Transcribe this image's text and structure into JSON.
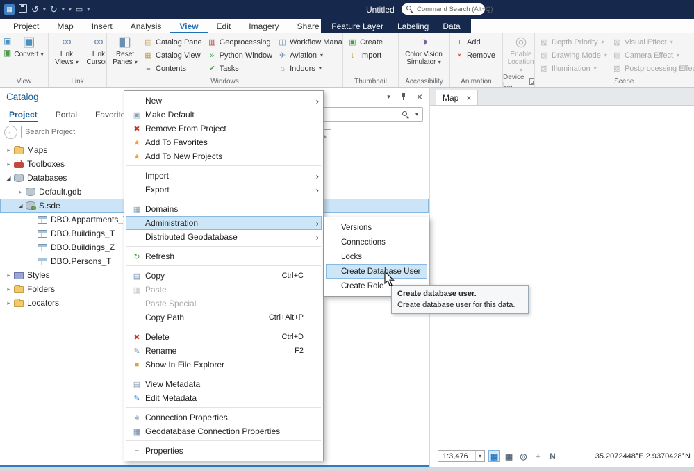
{
  "titlebar": {
    "title": "Untitled",
    "command_search_placeholder": "Command Search (Alt+Q)"
  },
  "ribbon_tabs": {
    "main": [
      "Project",
      "Map",
      "Insert",
      "Analysis",
      "View",
      "Edit",
      "Imagery",
      "Share"
    ],
    "active": "View",
    "contextual": [
      "Feature Layer",
      "Labeling",
      "Data"
    ]
  },
  "ribbon": {
    "groups": [
      {
        "label": "View",
        "minis": [
          "map-frame-icon",
          "scene-frame-icon"
        ],
        "big": [
          {
            "label": "Convert",
            "icon": "convert-icon",
            "dropdown": true
          }
        ]
      },
      {
        "label": "Link",
        "big": [
          {
            "label": "Link Views",
            "icon": "link-views-icon",
            "dropdown": true
          },
          {
            "label": "Link Cursors",
            "icon": "link-cursors-icon"
          }
        ]
      },
      {
        "label": "Windows",
        "big": [
          {
            "label": "Reset Panes",
            "icon": "reset-panes-icon",
            "dropdown": true
          }
        ],
        "small_cols": [
          [
            {
              "label": "Catalog Pane",
              "icon": "catalog-pane-icon"
            },
            {
              "label": "Catalog View",
              "icon": "catalog-view-icon"
            },
            {
              "label": "Contents",
              "icon": "contents-icon"
            }
          ],
          [
            {
              "label": "Geoprocessing",
              "icon": "geoprocessing-icon"
            },
            {
              "label": "Python Window",
              "icon": "python-window-icon"
            },
            {
              "label": "Tasks",
              "icon": "tasks-icon"
            }
          ],
          [
            {
              "label": "Workflow Manager",
              "icon": "workflow-manager-icon",
              "dropdown": true
            },
            {
              "label": "Aviation",
              "icon": "aviation-icon",
              "dropdown": true
            },
            {
              "label": "Indoors",
              "icon": "indoors-icon",
              "dropdown": true
            }
          ]
        ]
      },
      {
        "label": "Thumbnail",
        "small_cols": [
          [
            {
              "label": "Create",
              "icon": "create-thumbnail-icon"
            },
            {
              "label": "Import",
              "icon": "import-thumbnail-icon"
            }
          ]
        ]
      },
      {
        "label": "Accessibility",
        "big": [
          {
            "label": "Color Vision Simulator",
            "icon": "color-vision-simulator-icon",
            "dropdown": true
          }
        ]
      },
      {
        "label": "Animation",
        "small_cols": [
          [
            {
              "label": "Add",
              "icon": "add-icon"
            },
            {
              "label": "Remove",
              "icon": "animation-remove-icon"
            }
          ]
        ]
      },
      {
        "label": "Device L...",
        "launcher": true,
        "big": [
          {
            "label": "Enable Location",
            "icon": "enable-location-icon",
            "dropdown": true,
            "disabled": true
          }
        ]
      },
      {
        "label": "Scene",
        "small_cols": [
          [
            {
              "label": "Depth Priority",
              "icon": "scene-effect-icon",
              "dropdown": true,
              "disabled": true
            },
            {
              "label": "Drawing Mode",
              "icon": "scene-effect-icon",
              "dropdown": true,
              "disabled": true
            },
            {
              "label": "Illumination",
              "icon": "scene-effect-icon",
              "dropdown": true,
              "disabled": true
            }
          ],
          [
            {
              "label": "Visual Effect",
              "icon": "scene-effect-icon",
              "dropdown": true,
              "disabled": true
            },
            {
              "label": "Camera Effect",
              "icon": "scene-effect-icon",
              "dropdown": true,
              "disabled": true
            },
            {
              "label": "Postprocessing Effects",
              "icon": "scene-effect-icon",
              "dropdown": true,
              "disabled": true
            }
          ]
        ]
      }
    ]
  },
  "catalog_pane": {
    "title": "Catalog",
    "tabs": [
      "Project",
      "Portal",
      "Favorites"
    ],
    "active_tab": "Project",
    "search_placeholder": "Search Project",
    "tree": [
      {
        "label": "Maps",
        "depth": 0,
        "state": "collapsed",
        "icon": "folder-icon"
      },
      {
        "label": "Toolboxes",
        "depth": 0,
        "state": "collapsed",
        "icon": "toolbox-icon"
      },
      {
        "label": "Databases",
        "depth": 0,
        "state": "expanded",
        "icon": "databases-icon"
      },
      {
        "label": "Default.gdb",
        "depth": 1,
        "state": "collapsed",
        "icon": "geodatabase-icon"
      },
      {
        "label": "S.sde",
        "depth": 1,
        "state": "expanded",
        "icon": "sde-connection-icon",
        "selected": true
      },
      {
        "label": "DBO.Appartments_T",
        "depth": 2,
        "state": "leaf",
        "icon": "table-icon"
      },
      {
        "label": "DBO.Buildings_T",
        "depth": 2,
        "state": "leaf",
        "icon": "table-icon"
      },
      {
        "label": "DBO.Buildings_Z",
        "depth": 2,
        "state": "leaf",
        "icon": "table-icon"
      },
      {
        "label": "DBO.Persons_T",
        "depth": 2,
        "state": "leaf",
        "icon": "table-icon"
      },
      {
        "label": "Styles",
        "depth": 0,
        "state": "collapsed",
        "icon": "styles-icon"
      },
      {
        "label": "Folders",
        "depth": 0,
        "state": "collapsed",
        "icon": "folder-icon"
      },
      {
        "label": "Locators",
        "depth": 0,
        "state": "collapsed",
        "icon": "locator-icon"
      }
    ]
  },
  "context_menu": {
    "items": [
      {
        "label": "New",
        "submenu": true
      },
      {
        "label": "Make Default",
        "icon": "make-default-icon"
      },
      {
        "label": "Remove From Project",
        "icon": "remove-icon"
      },
      {
        "label": "Add To Favorites",
        "icon": "favorite-star-icon"
      },
      {
        "label": "Add To New Projects",
        "icon": "favorite-star-icon"
      },
      {
        "type": "separator"
      },
      {
        "label": "Import",
        "submenu": true
      },
      {
        "label": "Export",
        "submenu": true
      },
      {
        "type": "separator"
      },
      {
        "label": "Domains",
        "icon": "domains-icon"
      },
      {
        "label": "Administration",
        "submenu": true,
        "highlighted": true
      },
      {
        "label": "Distributed Geodatabase",
        "submenu": true
      },
      {
        "type": "separator"
      },
      {
        "label": "Refresh",
        "icon": "refresh-icon"
      },
      {
        "type": "separator"
      },
      {
        "label": "Copy",
        "shortcut": "Ctrl+C",
        "icon": "copy-icon"
      },
      {
        "label": "Paste",
        "disabled": true,
        "icon": "paste-icon"
      },
      {
        "label": "Paste Special",
        "disabled": true
      },
      {
        "label": "Copy Path",
        "shortcut": "Ctrl+Alt+P"
      },
      {
        "type": "separator"
      },
      {
        "label": "Delete",
        "shortcut": "Ctrl+D",
        "icon": "delete-icon"
      },
      {
        "label": "Rename",
        "shortcut": "F2",
        "icon": "rename-icon"
      },
      {
        "label": "Show In File Explorer",
        "icon": "file-explorer-icon"
      },
      {
        "type": "separator"
      },
      {
        "label": "View Metadata",
        "icon": "view-metadata-icon"
      },
      {
        "label": "Edit Metadata",
        "icon": "edit-metadata-icon"
      },
      {
        "type": "separator"
      },
      {
        "label": "Connection Properties",
        "icon": "connection-properties-icon"
      },
      {
        "label": "Geodatabase Connection Properties",
        "icon": "gdb-connection-properties-icon"
      },
      {
        "type": "separator"
      },
      {
        "label": "Properties",
        "icon": "properties-icon"
      }
    ]
  },
  "submenu": {
    "items": [
      {
        "label": "Versions"
      },
      {
        "label": "Connections"
      },
      {
        "label": "Locks"
      },
      {
        "label": "Create Database User",
        "highlighted": true
      },
      {
        "label": "Create Role"
      }
    ]
  },
  "tooltip": {
    "title": "Create database user.",
    "body": "Create database user for this data."
  },
  "map_view": {
    "tab_label": "Map",
    "scale": "1:3,476",
    "coordinates": "35.2072448°E 2.9370428°N",
    "statusbar_icons": [
      "table-grid-icon",
      "layout-grid-icon",
      "spatial-reference-icon",
      "crosshair-icon",
      "north-arrow-icon"
    ]
  },
  "icon_glyphs": {
    "map-frame-icon": [
      "▣",
      "#4b8fbf"
    ],
    "scene-frame-icon": [
      "▣",
      "#4a9a4a"
    ],
    "convert-icon": [
      "▣",
      "#4b8fbf"
    ],
    "link-views-icon": [
      "∞",
      "#6c8eb0"
    ],
    "link-cursors-icon": [
      "∞",
      "#6c8eb0"
    ],
    "reset-panes-icon": [
      "◧",
      "#6c8eb0"
    ],
    "catalog-pane-icon": [
      "▤",
      "#bf9a3f"
    ],
    "catalog-view-icon": [
      "▦",
      "#bf9a3f"
    ],
    "contents-icon": [
      "≡",
      "#6c8eb0"
    ],
    "geoprocessing-icon": [
      "▥",
      "#b03a2e"
    ],
    "python-window-icon": [
      "»",
      "#3e9b3e"
    ],
    "tasks-icon": [
      "✔",
      "#3e9b3e"
    ],
    "workflow-manager-icon": [
      "◫",
      "#6c8eb0"
    ],
    "aviation-icon": [
      "✈",
      "#6c8eb0"
    ],
    "indoors-icon": [
      "⌂",
      "#6c8eb0"
    ],
    "create-thumbnail-icon": [
      "▣",
      "#4a9a4a"
    ],
    "import-thumbnail-icon": [
      "↓",
      "#c79a2e"
    ],
    "color-vision-simulator-icon": [
      "◑",
      "#7a5fa0"
    ],
    "add-icon": [
      "+",
      "#3e9b3e"
    ],
    "animation-remove-icon": [
      "×",
      "#c0392b"
    ],
    "enable-location-icon": [
      "◎",
      "#a8a8a8"
    ],
    "scene-effect-icon": [
      "▧",
      "#b3b3b3"
    ],
    "make-default-icon": [
      "▣",
      "#8aa0b4"
    ],
    "remove-icon": [
      "✖",
      "#c0392b"
    ],
    "favorite-star-icon": [
      "★",
      "#e8a33d"
    ],
    "domains-icon": [
      "▦",
      "#8aa0b4"
    ],
    "refresh-icon": [
      "↻",
      "#3e9b3e"
    ],
    "copy-icon": [
      "▤",
      "#6c8eb0"
    ],
    "paste-icon": [
      "▥",
      "#b5b5b5"
    ],
    "delete-icon": [
      "✖",
      "#c0392b"
    ],
    "rename-icon": [
      "✎",
      "#6c8eb0"
    ],
    "file-explorer-icon": [
      "■",
      "#d9a441"
    ],
    "view-metadata-icon": [
      "▤",
      "#8aa0b4"
    ],
    "edit-metadata-icon": [
      "✎",
      "#2d7dd2"
    ],
    "connection-properties-icon": [
      "∗",
      "#8aa0b4"
    ],
    "gdb-connection-properties-icon": [
      "▦",
      "#6c8eb0"
    ],
    "properties-icon": [
      "≡",
      "#8aa0b4"
    ],
    "table-grid-icon": [
      "▦",
      "#2e7cc4"
    ],
    "layout-grid-icon": [
      "▦",
      "#5a6b7a"
    ],
    "spatial-reference-icon": [
      "◎",
      "#5a6b7a"
    ],
    "crosshair-icon": [
      "+",
      "#5a6b7a"
    ],
    "north-arrow-icon": [
      "N",
      "#5a6b7a"
    ]
  }
}
